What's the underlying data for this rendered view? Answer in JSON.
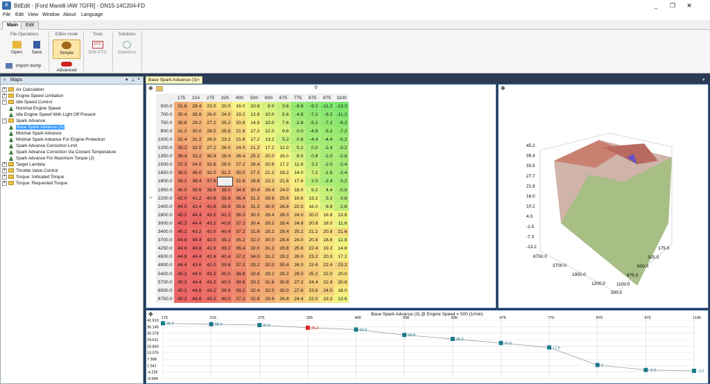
{
  "window": {
    "title": "BitEdit - [Ford Marelli IAW 7GFR] - DN15-14C204-FD",
    "icon": "B",
    "min": "_",
    "max": "❐",
    "close": "✕"
  },
  "menu": [
    "File",
    "Edit",
    "View",
    "Window",
    "About",
    "Language"
  ],
  "ribbon_tabs": [
    "Main",
    "Edit"
  ],
  "ribbon": {
    "file_operations": {
      "title": "File Operations",
      "open": "Open",
      "save": "Save",
      "import": "Import dump"
    },
    "editor_mode": {
      "title": "Editor mode",
      "simple": "Simple",
      "advanced": "Advanced"
    },
    "tools": {
      "title": "Tools",
      "edit_dtc": "Edit DTC",
      "dtc_badge": "DTC"
    },
    "solutions": {
      "title": "Solutions",
      "solutions": "Solutions"
    }
  },
  "maps_panel": {
    "title": "Maps",
    "items": [
      {
        "label": "Air Calculation",
        "level": 0,
        "type": "folder",
        "exp": "+"
      },
      {
        "label": "Engine Speed Limitation",
        "level": 0,
        "type": "folder",
        "exp": "+"
      },
      {
        "label": "Idle Speed Control",
        "level": 0,
        "type": "folder",
        "exp": "−"
      },
      {
        "label": "Nominal Engine Speed",
        "level": 1,
        "type": "map"
      },
      {
        "label": "Idle Engine Speed With Light Off Present",
        "level": 1,
        "type": "map"
      },
      {
        "label": "Spark Advance",
        "level": 0,
        "type": "folder",
        "exp": "−"
      },
      {
        "label": "Base Spark Advance (3)",
        "level": 1,
        "type": "map",
        "selected": true
      },
      {
        "label": "Minimal Spark Advance",
        "level": 1,
        "type": "map"
      },
      {
        "label": "Minimal Spark Advance For Engine Protection",
        "level": 1,
        "type": "map"
      },
      {
        "label": "Spark Advance Correction Limit",
        "level": 1,
        "type": "map"
      },
      {
        "label": "Spark Advance Correction Via Coolant Temperature",
        "level": 1,
        "type": "map"
      },
      {
        "label": "Spark Advance For Maximum Torque (2)",
        "level": 1,
        "type": "map"
      },
      {
        "label": "Target Lambda",
        "level": 0,
        "type": "folder",
        "exp": "+"
      },
      {
        "label": "Throttle Valve Control",
        "level": 0,
        "type": "folder",
        "exp": "+"
      },
      {
        "label": "Torque: Indicated Torque",
        "level": 0,
        "type": "folder",
        "exp": "+"
      },
      {
        "label": "Torque: Requested Torque",
        "level": 0,
        "type": "folder",
        "exp": "+"
      }
    ]
  },
  "document_tab": "Base Spark Advance (3)",
  "table": {
    "corner_value": "0",
    "columns": [
      "175",
      "215",
      "275",
      "325",
      "400",
      "500",
      "600",
      "675",
      "775",
      "875",
      "975",
      "1100"
    ],
    "rows": [
      {
        "rpm": "500.0",
        "v": [
          "31.6",
          "28.4",
          "22.0",
          "20.0",
          "16.0",
          "10.8",
          "8.0",
          "3.6",
          "-6.8",
          "-9.2",
          "-11.2",
          "-13.2"
        ]
      },
      {
        "rpm": "700.0",
        "v": [
          "30.4",
          "28.8",
          "26.0",
          "24.0",
          "19.2",
          "12.8",
          "10.0",
          "5.6",
          "-4.8",
          "-7.2",
          "-9.2",
          "-11.2"
        ]
      },
      {
        "rpm": "750.0",
        "v": [
          "30.8",
          "29.2",
          "27.2",
          "25.2",
          "20.8",
          "14.8",
          "10.0",
          "7.6",
          "-2.8",
          "-5.2",
          "-7.2",
          "-9.2"
        ]
      },
      {
        "rpm": "800.0",
        "v": [
          "31.2",
          "30.0",
          "28.0",
          "25.6",
          "21.6",
          "17.2",
          "12.0",
          "9.6",
          "0.0",
          "-4.8",
          "-5.2",
          "-7.2"
        ]
      },
      {
        "rpm": "1000.0",
        "v": [
          "32.4",
          "31.2",
          "26.0",
          "23.2",
          "21.6",
          "17.2",
          "13.2",
          "5.2",
          "0.8",
          "-4.4",
          "-4.4",
          "-5.2"
        ]
      },
      {
        "rpm": "1200.0",
        "v": [
          "35.2",
          "32.0",
          "27.2",
          "26.0",
          "24.0",
          "21.2",
          "17.2",
          "12.0",
          "5.2",
          "0.0",
          "-2.4",
          "-3.2"
        ]
      },
      {
        "rpm": "1350.0",
        "v": [
          "36.4",
          "33.2",
          "30.4",
          "28.4",
          "26.4",
          "25.2",
          "20.0",
          "16.0",
          "8.0",
          "0.8",
          "-2.0",
          "-2.8"
        ]
      },
      {
        "rpm": "1500.0",
        "v": [
          "37.2",
          "34.0",
          "31.6",
          "28.0",
          "27.2",
          "26.4",
          "20.8",
          "17.2",
          "11.6",
          "3.2",
          "-2.0",
          "-2.4"
        ]
      },
      {
        "rpm": "1650.0",
        "v": [
          "38.0",
          "36.0",
          "32.0",
          "31.2",
          "30.0",
          "27.2",
          "21.2",
          "19.2",
          "14.0",
          "7.2",
          "-1.6",
          "-2.4"
        ]
      },
      {
        "rpm": "1800.0",
        "v": [
          "39.2",
          "38.4",
          "37.6",
          "",
          "31.6",
          "28.8",
          "23.2",
          "21.6",
          "17.6",
          "2.0",
          "-2.4",
          "-3.2"
        ]
      },
      {
        "rpm": "1950.0",
        "v": [
          "40.0",
          "39.6",
          "38.8",
          "38.0",
          "34.8",
          "30.4",
          "26.4",
          "24.0",
          "18.0",
          "9.2",
          "4.4",
          "-0.8"
        ]
      },
      {
        "rpm": "2200.0",
        "v": [
          "42.0",
          "41.2",
          "40.8",
          "38.8",
          "36.4",
          "31.2",
          "28.8",
          "25.6",
          "19.6",
          "13.2",
          "5.2",
          "0.8"
        ]
      },
      {
        "rpm": "2400.0",
        "v": [
          "44.0",
          "42.4",
          "42.8",
          "38.8",
          "35.6",
          "31.2",
          "30.0",
          "26.8",
          "22.0",
          "16.0",
          "8.8",
          "2.8"
        ]
      },
      {
        "rpm": "2800.0",
        "v": [
          "45.2",
          "44.4",
          "43.2",
          "41.2",
          "36.0",
          "30.0",
          "28.4",
          "28.0",
          "24.0",
          "20.0",
          "16.8",
          "13.6"
        ]
      },
      {
        "rpm": "3000.0",
        "v": [
          "45.2",
          "44.4",
          "43.2",
          "40.8",
          "37.2",
          "30.4",
          "29.2",
          "28.4",
          "24.8",
          "20.8",
          "18.0",
          "11.6"
        ]
      },
      {
        "rpm": "3400.0",
        "v": [
          "45.2",
          "43.2",
          "42.0",
          "40.4",
          "37.2",
          "31.6",
          "29.2",
          "28.4",
          "25.2",
          "21.2",
          "20.8",
          "21.6"
        ]
      },
      {
        "rpm": "3700.0",
        "v": [
          "44.8",
          "44.4",
          "42.0",
          "39.2",
          "35.2",
          "32.0",
          "30.0",
          "28.4",
          "24.0",
          "20.8",
          "18.8",
          "12.8"
        ]
      },
      {
        "rpm": "4250.0",
        "v": [
          "44.8",
          "44.8",
          "41.6",
          "39.2",
          "36.4",
          "32.0",
          "31.2",
          "28.8",
          "25.6",
          "22.4",
          "19.2",
          "14.8"
        ]
      },
      {
        "rpm": "4500.0",
        "v": [
          "44.8",
          "44.4",
          "42.4",
          "40.4",
          "37.2",
          "34.0",
          "31.2",
          "29.2",
          "26.0",
          "23.2",
          "20.0",
          "17.2"
        ]
      },
      {
        "rpm": "4900.0",
        "v": [
          "44.4",
          "43.6",
          "42.0",
          "39.6",
          "37.2",
          "33.2",
          "32.0",
          "30.4",
          "26.0",
          "23.6",
          "22.4",
          "23.2"
        ]
      },
      {
        "rpm": "5400.0",
        "v": [
          "45.2",
          "44.0",
          "43.2",
          "40.0",
          "38.8",
          "32.8",
          "29.2",
          "29.2",
          "28.0",
          "25.2",
          "22.0",
          "20.0"
        ]
      },
      {
        "rpm": "5700.0",
        "v": [
          "45.2",
          "44.4",
          "43.2",
          "40.0",
          "39.6",
          "33.2",
          "31.6",
          "30.8",
          "27.2",
          "24.4",
          "22.8",
          "20.8"
        ]
      },
      {
        "rpm": "6000.0",
        "v": [
          "45.2",
          "44.8",
          "43.2",
          "39.6",
          "39.2",
          "32.4",
          "32.0",
          "30.0",
          "27.6",
          "23.6",
          "24.0",
          "18.0"
        ]
      },
      {
        "rpm": "6750.0",
        "v": [
          "45.2",
          "44.8",
          "43.2",
          "40.0",
          "37.2",
          "32.8",
          "29.6",
          "26.8",
          "24.4",
          "22.0",
          "19.2",
          "13.6"
        ]
      }
    ]
  },
  "chart3d": {
    "z_ticks": [
      "45.2",
      "39.4",
      "33.5",
      "27.7",
      "21.8",
      "16.0",
      "10.2",
      "4.3",
      "-1.5",
      "-7.3",
      "-13.2"
    ],
    "load_ticks": [
      "175.0",
      "325.0",
      "600.0",
      "875.0",
      "1100.0"
    ],
    "rpm_ticks": [
      "6750.0",
      "3700.0",
      "1950.0",
      "1200.0",
      "500.0"
    ]
  },
  "chart2d": {
    "title": "Base Spark Advance (3) @ Engine Speed = 500 (1/min)",
    "x_ticks": [
      "175",
      "215",
      "275",
      "325",
      "400",
      "500",
      "600",
      "675",
      "775",
      "875",
      "975",
      "1100"
    ],
    "y_ticks": [
      "41.913",
      "36.145",
      "30.378",
      "24.611",
      "18.843",
      "13.076",
      "7.308",
      "1.541",
      "-4.226",
      "-9.994"
    ],
    "point_labels": [
      "39.2",
      "38.4",
      "37.6",
      "35.2",
      "33.6",
      "28.8",
      "25.2",
      "21.6",
      "17.6",
      "2",
      "-2.4",
      "-3.2"
    ],
    "highlight_index": 3,
    "colors": {
      "point": "#1a7a8a",
      "highlight": "#e02020",
      "line": "#999999"
    }
  },
  "chart_data": {
    "type": "line",
    "title": "Base Spark Advance (3) @ Engine Speed = 500 (1/min)",
    "x": [
      175,
      215,
      275,
      325,
      400,
      500,
      600,
      675,
      775,
      875,
      975,
      1100
    ],
    "series": [
      {
        "values": [
          39.2,
          38.4,
          37.6,
          35.2,
          33.6,
          28.8,
          25.2,
          21.6,
          17.6,
          2,
          -2.4,
          -3.2
        ]
      }
    ],
    "ylim": [
      -9.994,
      41.913
    ]
  }
}
